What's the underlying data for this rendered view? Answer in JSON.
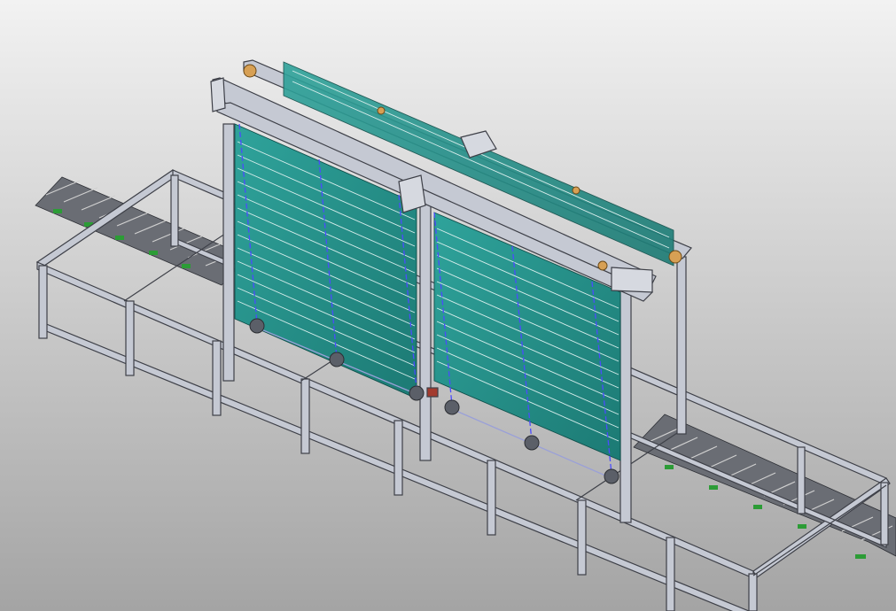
{
  "viewport": {
    "label": "",
    "background_top": "#f2f2f2",
    "background_bottom": "#a4a4a4"
  },
  "model": {
    "frame_color": "#c5c9d3",
    "frame_edge": "#3e4048",
    "panel_color": "#2a9a93",
    "panel_edge": "#0f4f4a",
    "pulley_color": "#d7a054",
    "chain_color": "#4b4bff",
    "conveyor_color": "#8c8f96",
    "accent_green": "#2c9c36"
  }
}
